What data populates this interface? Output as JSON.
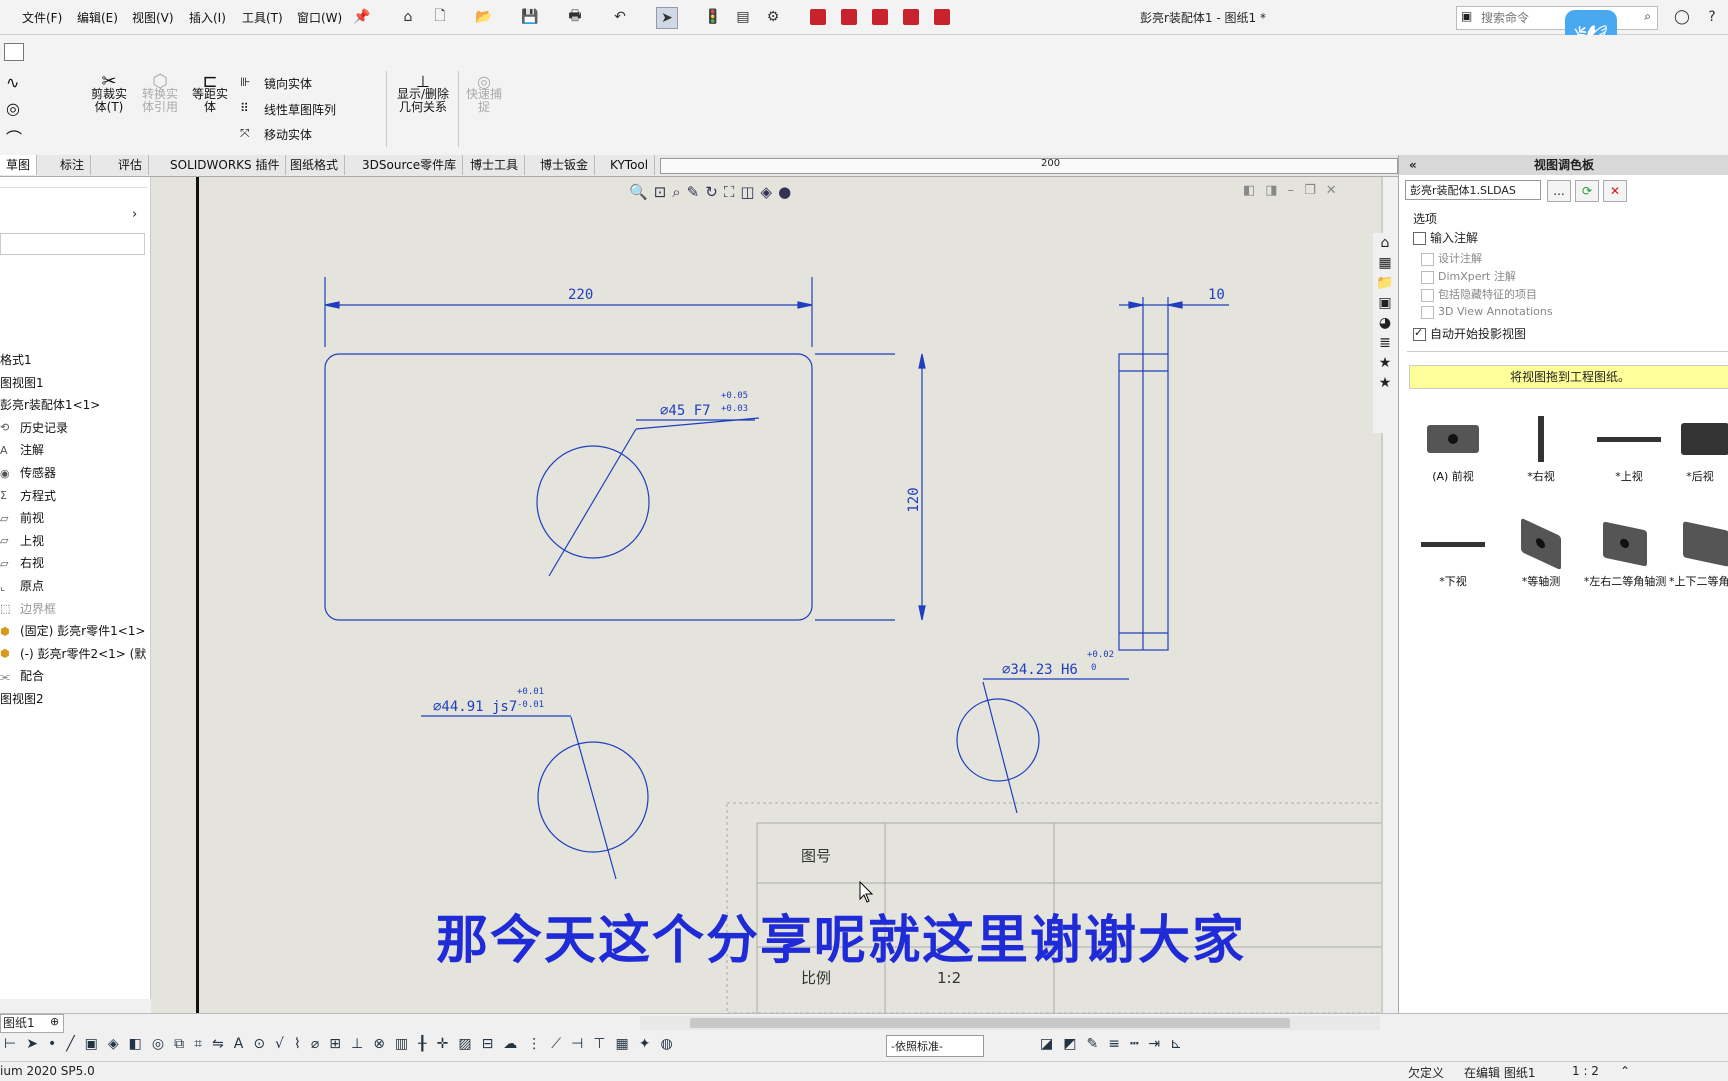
{
  "menubar": {
    "items": [
      "文件(F)",
      "编辑(E)",
      "视图(V)",
      "插入(I)",
      "工具(T)",
      "窗口(W)"
    ],
    "title": "彭亮r装配体1 - 图纸1 *",
    "search_placeholder": "搜索命令"
  },
  "ribbon": {
    "trim": "剪裁实体(T)",
    "convert": "转换实体引用",
    "offset": "等距实体",
    "mirror": "镜向实体",
    "linear_pattern": "线性草图阵列",
    "move": "移动实体",
    "display_delete": "显示/删除几何关系",
    "quick_snap": "快速捕捉"
  },
  "tabs": [
    "草图",
    "标注",
    "评估",
    "SOLIDWORKS 插件",
    "图纸格式",
    "3DSource零件库",
    "博士工具",
    "博士钣金",
    "KYTool"
  ],
  "ruler_label": "200",
  "tree": {
    "items": [
      {
        "label": "格式1",
        "icon": "none"
      },
      {
        "label": "图视图1",
        "icon": "none"
      },
      {
        "label": "彭亮r装配体1<1>",
        "icon": "none"
      },
      {
        "label": "历史记录",
        "icon": "history-icon"
      },
      {
        "label": "注解",
        "icon": "annotation-icon"
      },
      {
        "label": "传感器",
        "icon": "sensor-icon"
      },
      {
        "label": "方程式",
        "icon": "equation-icon"
      },
      {
        "label": "前视",
        "icon": "plane-icon"
      },
      {
        "label": "上视",
        "icon": "plane-icon"
      },
      {
        "label": "右视",
        "icon": "plane-icon"
      },
      {
        "label": "原点",
        "icon": "origin-icon"
      },
      {
        "label": "边界框",
        "icon": "bbox-icon"
      },
      {
        "label": "(固定) 彭亮r零件1<1>",
        "icon": "part-icon"
      },
      {
        "label": "(-) 彭亮r零件2<1> (默",
        "icon": "part-icon"
      },
      {
        "label": "配合",
        "icon": "mate-icon"
      },
      {
        "label": "图视图2",
        "icon": "none"
      }
    ]
  },
  "drawing": {
    "dim_width": "220",
    "dim_height": "120",
    "dim_thickness": "10",
    "hole1": "∅45 F7",
    "hole1_tol_upper": "+0.05",
    "hole1_tol_lower": "+0.03",
    "hole2": "∅44.91 js7",
    "hole2_tol_upper": "+0.01",
    "hole2_tol_lower": "-0.01",
    "hole3": "∅34.23 H6",
    "hole3_tol_upper": "+0.02",
    "hole3_tol_lower": "0",
    "titleblock_drawing_no": "图号",
    "titleblock_scale_label": "比例",
    "titleblock_scale_value": "1:2"
  },
  "right_panel": {
    "title": "视图调色板",
    "document": "彭亮r装配体1.SLDAS",
    "browse_label": "...",
    "options_label": "选项",
    "import_annotations": "输入注解",
    "design_annotations": "设计注解",
    "dimxpert": "DimXpert 注解",
    "hidden_features": "包括隐藏特征的项目",
    "view_annotations_3d": "3D View Annotations",
    "auto_projection": "自动开始投影视图",
    "drag_hint": "将视图拖到工程图纸。",
    "views": [
      "(A) 前视",
      "*右视",
      "*上视",
      "*后视",
      "*下视",
      "*等轴测",
      "*左右二等角轴测",
      "*上下二等角测"
    ]
  },
  "bottom": {
    "sheet_tab": "图纸1",
    "standard": "-依照标准-",
    "version": "ium 2020 SP5.0",
    "status_undefined": "欠定义",
    "status_editing": "在编辑 图纸1",
    "status_scale": "1 : 2"
  },
  "subtitle": "那今天这个分享呢就这里谢谢大家",
  "colors": {
    "accent": "#1f2bd6",
    "dimension": "#1f3fbf",
    "highlight": "#ffff99",
    "drawing_bg": "#e4e4dc"
  }
}
